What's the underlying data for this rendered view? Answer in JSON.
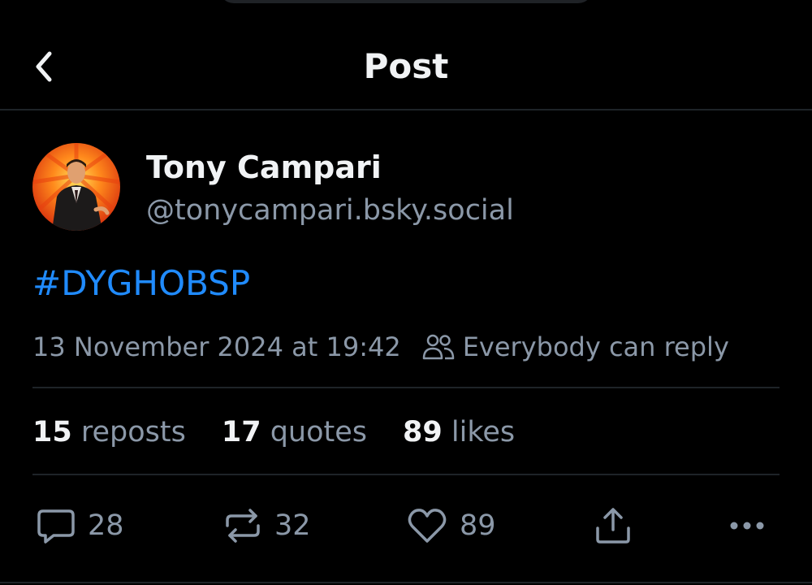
{
  "header": {
    "title": "Post"
  },
  "post": {
    "author": {
      "display_name": "Tony Campari",
      "handle": "@tonycampari.bsky.social"
    },
    "text": "#DYGHOBSP",
    "timestamp": "13 November 2024 at 19:42",
    "reply_setting": "Everybody can reply"
  },
  "stats": {
    "reposts": {
      "count": "15",
      "label": "reposts"
    },
    "quotes": {
      "count": "17",
      "label": "quotes"
    },
    "likes": {
      "count": "89",
      "label": "likes"
    }
  },
  "actions": {
    "reply_count": "28",
    "repost_count": "32",
    "like_count": "89"
  },
  "icons": {
    "back": "chevron-left-icon",
    "reply_setting": "people-icon",
    "reply": "speech-bubble-icon",
    "repost": "repost-arrows-icon",
    "like": "heart-icon",
    "share": "share-upload-icon",
    "more": "more-dots-icon"
  },
  "colors": {
    "background": "#000000",
    "text_primary": "#f1f3f5",
    "text_secondary": "#8b98a8",
    "link": "#208bfe",
    "divider": "#1e2328"
  }
}
